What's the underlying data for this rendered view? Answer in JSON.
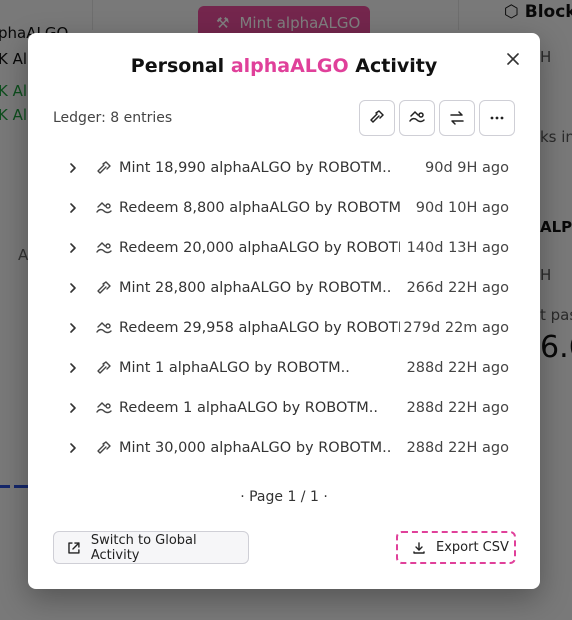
{
  "background": {
    "fragments": [
      "phaALGO",
      "K Al",
      "K Al",
      "K Al",
      "Block",
      "Al",
      "H",
      "ks in",
      "ALPH",
      "H",
      "t pas",
      "6.6"
    ],
    "mint_button_label": "Mint alphaALGO"
  },
  "modal": {
    "title_prefix": "Personal ",
    "title_accent": "alphaALGO",
    "title_suffix": " Activity",
    "accent_color": "#e0409a",
    "ledger_label": "Ledger: 8 entries",
    "toolbar": [
      {
        "icon": "hammer-icon"
      },
      {
        "icon": "redeem-icon"
      },
      {
        "icon": "swap-icon"
      },
      {
        "icon": "more-icon"
      }
    ],
    "entries": [
      {
        "type": "mint",
        "text": "Mint 18,990 alphaALGO by ROBOTM..",
        "time": "90d 9H ago"
      },
      {
        "type": "redeem",
        "text": "Redeem 8,800 alphaALGO by ROBOTM..",
        "time": "90d 10H ago"
      },
      {
        "type": "redeem",
        "text": "Redeem 20,000 alphaALGO by ROBOTM..",
        "time": "140d 13H ago"
      },
      {
        "type": "mint",
        "text": "Mint 28,800 alphaALGO by ROBOTM..",
        "time": "266d 22H ago"
      },
      {
        "type": "redeem",
        "text": "Redeem 29,958 alphaALGO by ROBOTM..",
        "time": "279d 22m ago"
      },
      {
        "type": "mint",
        "text": "Mint 1 alphaALGO by ROBOTM..",
        "time": "288d 22H ago"
      },
      {
        "type": "redeem",
        "text": "Redeem 1 alphaALGO by ROBOTM..",
        "time": "288d 22H ago"
      },
      {
        "type": "mint",
        "text": "Mint 30,000 alphaALGO by ROBOTM..",
        "time": "288d 22H ago"
      }
    ],
    "pager": "· Page 1 / 1 ·",
    "switch_button_label": "Switch to Global Activity",
    "export_button_label": "Export CSV"
  }
}
